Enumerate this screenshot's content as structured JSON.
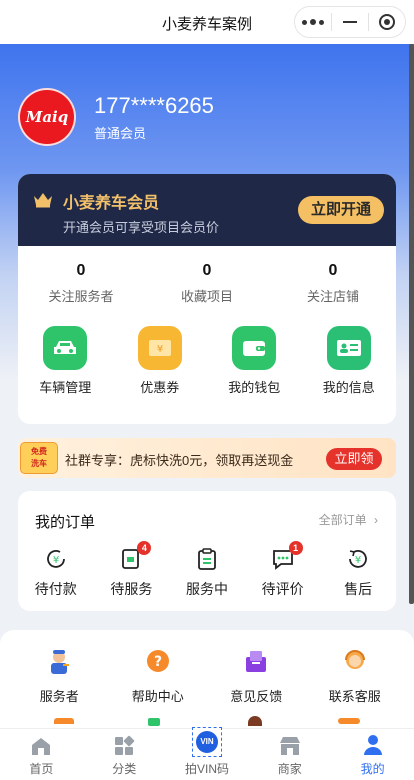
{
  "window": {
    "title": "小麦养车案例"
  },
  "profile": {
    "avatar_text": "Maiq",
    "phone": "177****6265",
    "level": "普通会员"
  },
  "vip": {
    "title": "小麦养车会员",
    "subtitle": "开通会员可享受项目会员价",
    "button": "立即开通"
  },
  "stats": [
    {
      "value": "0",
      "label": "关注服务者"
    },
    {
      "value": "0",
      "label": "收藏项目"
    },
    {
      "value": "0",
      "label": "关注店铺"
    }
  ],
  "quick_actions": [
    {
      "label": "车辆管理",
      "icon": "car-icon",
      "color": "#2fc46a"
    },
    {
      "label": "优惠券",
      "icon": "coupon-icon",
      "color": "#f7b733"
    },
    {
      "label": "我的钱包",
      "icon": "wallet-icon",
      "color": "#2fc46a"
    },
    {
      "label": "我的信息",
      "icon": "id-card-icon",
      "color": "#2bbf76"
    }
  ],
  "promo": {
    "tag_line1": "免费",
    "tag_line2": "洗车",
    "text": "社群专享：虎标快洗0元，领取再送现金",
    "button": "立即领"
  },
  "orders": {
    "title": "我的订单",
    "all_link": "全部订单",
    "items": [
      {
        "label": "待付款",
        "icon": "yen-pending-icon",
        "badge": ""
      },
      {
        "label": "待服务",
        "icon": "service-doc-icon",
        "badge": "4"
      },
      {
        "label": "服务中",
        "icon": "clipboard-icon",
        "badge": ""
      },
      {
        "label": "待评价",
        "icon": "comment-icon",
        "badge": "1"
      },
      {
        "label": "售后",
        "icon": "refund-icon",
        "badge": ""
      }
    ]
  },
  "tools": [
    {
      "label": "服务者",
      "icon": "mechanic-icon"
    },
    {
      "label": "帮助中心",
      "icon": "help-icon"
    },
    {
      "label": "意见反馈",
      "icon": "feedback-icon"
    },
    {
      "label": "联系客服",
      "icon": "support-icon"
    }
  ],
  "tabbar": [
    {
      "label": "首页",
      "icon": "home-icon",
      "active": false
    },
    {
      "label": "分类",
      "icon": "category-icon",
      "active": false
    },
    {
      "label": "拍VIN码",
      "icon": "vin-scan-icon",
      "active": false,
      "badge_text": "VIN"
    },
    {
      "label": "商家",
      "icon": "shop-icon",
      "active": false
    },
    {
      "label": "我的",
      "icon": "user-icon",
      "active": true
    }
  ],
  "colors": {
    "primary": "#2f6ff0",
    "vip_bg": "#1f2947",
    "gold": "#f3c06a",
    "badge_red": "#e5322b"
  }
}
